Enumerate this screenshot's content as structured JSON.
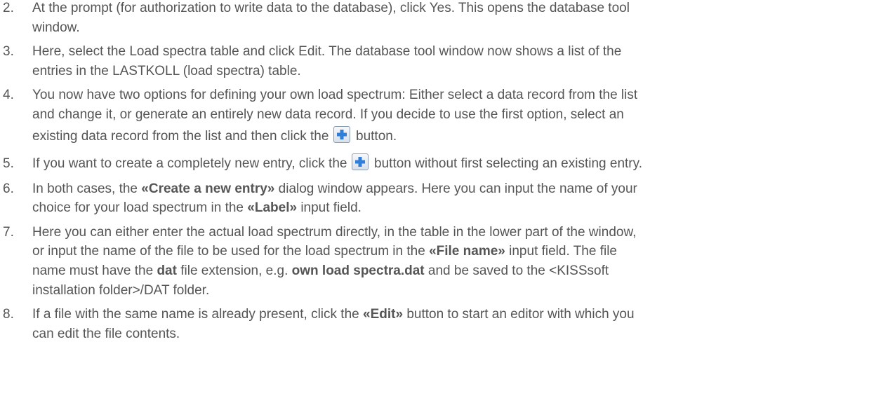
{
  "steps": [
    {
      "number": "2.",
      "line1": "At the prompt (for authorization to write data to the database), click Yes. This opens the database tool",
      "line2": "window."
    },
    {
      "number": "3.",
      "line1": "Here, select the Load spectra table and click Edit. The database tool window now shows a list of the",
      "line2": "entries in the LASTKOLL (load spectra) table."
    },
    {
      "number": "4.",
      "line1": "You now have two options for defining your own load spectrum: Either select a data record from the list",
      "line2": "and change it, or generate an entirely new data record. If you decide to use the first option, select an",
      "line3_a": "existing data record from the list and then click the",
      "line3_b": "button.",
      "icon": "plus-icon"
    },
    {
      "number": "5.",
      "line1_a": "If you want to create a completely new entry, click the",
      "line1_b": "button without first selecting an existing entry.",
      "icon": "plus-icon"
    },
    {
      "number": "6.",
      "line1_a": "In both cases, the",
      "line1_bold": "«Create a new entry»",
      "line1_b": "dialog window appears. Here you can input the name of your",
      "line2_a": "choice for your load spectrum in the",
      "line2_bold": "«Label»",
      "line2_b": "input field."
    },
    {
      "number": "7.",
      "line1": "Here you can either enter the actual load spectrum directly, in the table in the lower part of the window,",
      "line2_a": "or input the name of the file to be used for the load spectrum in the",
      "line2_bold": "«File name»",
      "line2_b": "input field. The file",
      "line3_a": "name must have the",
      "line3_bold1": "dat",
      "line3_b": "file extension, e.g.",
      "line3_bold2": "own load spectra.dat",
      "line3_c": "and be saved to the <KISSsoft",
      "line4": "installation folder>/DAT folder."
    },
    {
      "number": "8.",
      "line1_a": "If a file with the same name is already present, click the",
      "line1_bold": "«Edit»",
      "line1_b": "button to start an editor with which you",
      "line2": "can edit the file contents."
    }
  ],
  "colors": {
    "text": "#555555",
    "icon_blue": "#2f7fd8"
  }
}
